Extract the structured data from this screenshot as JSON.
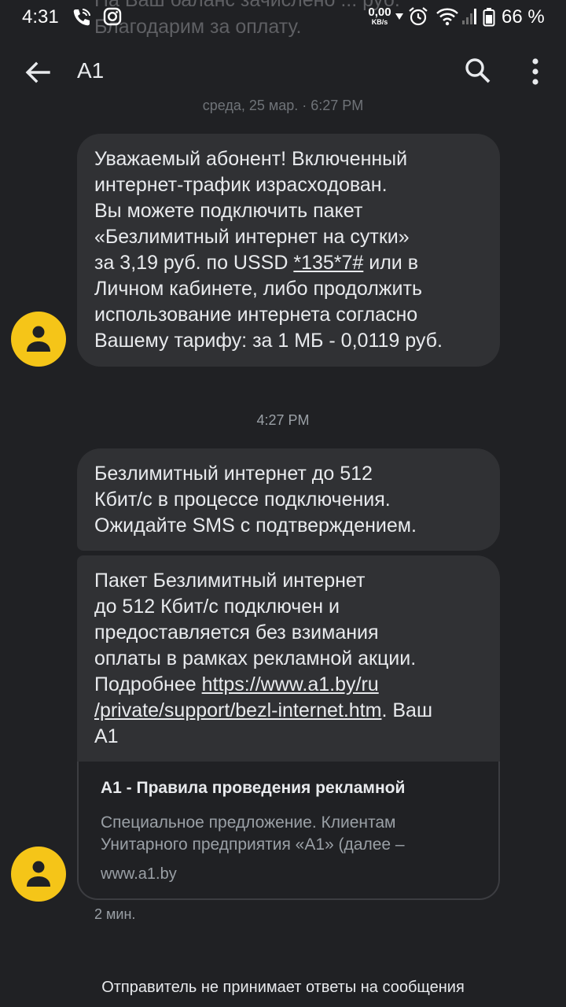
{
  "status_bar": {
    "time": "4:31",
    "net_speed_value": "0,00",
    "net_speed_unit": "KB/s",
    "battery": "66 %",
    "icons": [
      "phone-wifi-icon",
      "instagram-icon",
      "alarm-icon",
      "wifi-icon",
      "signal-icon",
      "battery-icon"
    ]
  },
  "notification_ghost": {
    "line1": "На Ваш баланс зачислено ... руб.",
    "line2": "Благодарим за оплату."
  },
  "app_bar": {
    "title": "A1",
    "icons": [
      "back-arrow-icon",
      "search-icon",
      "more-vert-icon"
    ]
  },
  "conversation": {
    "date_separator_1": "среда, 25 мар. · 6:27 PM",
    "message_1": {
      "line1": "Уважаемый абонент! Включенный",
      "line2": "интернет-трафик израсходован.",
      "line3": "Вы можете подключить пакет",
      "line4": "«Безлимитный интернет на сутки»",
      "line5_pre": "за 3,19 руб. по USSD ",
      "ussd_code": "*135*7#",
      "line5_post": " или в",
      "line6": "Личном кабинете, либо продолжить",
      "line7": "использование интернета согласно",
      "line8": "Вашему тарифу: за 1 МБ - 0,0119 руб."
    },
    "date_separator_2": "4:27 PM",
    "message_2": {
      "line1": "Безлимитный интернет до 512",
      "line2": "Кбит/с в процессе подключения.",
      "line3": "Ожидайте SMS с подтверждением."
    },
    "message_3": {
      "line1": "Пакет Безлимитный интернет",
      "line2": "до 512 Кбит/с подключен и",
      "line3": "предоставляется без взимания",
      "line4": "оплаты в рамках рекламной акции.",
      "line5_pre": "Подробнее ",
      "link_part1": "https://www.a1.by/ru",
      "link_part2": "/private/support/bezl-internet.htm",
      "line6_post": ". Ваш",
      "line7": "А1"
    },
    "link_preview": {
      "title": "А1 - Правила проведения рекламной",
      "description_line1": "Специальное предложение. Клиентам",
      "description_line2": "Унитарного предприятия «А1» (далее –",
      "domain": "www.a1.by"
    },
    "message_time": "2 мин.",
    "footer_note": "Отправитель не принимает ответы на сообщения"
  },
  "colors": {
    "background": "#202124",
    "bubble": "#303134",
    "avatar": "#f5c518",
    "text": "#e8eaed",
    "secondary_text": "#9aa0a6"
  }
}
